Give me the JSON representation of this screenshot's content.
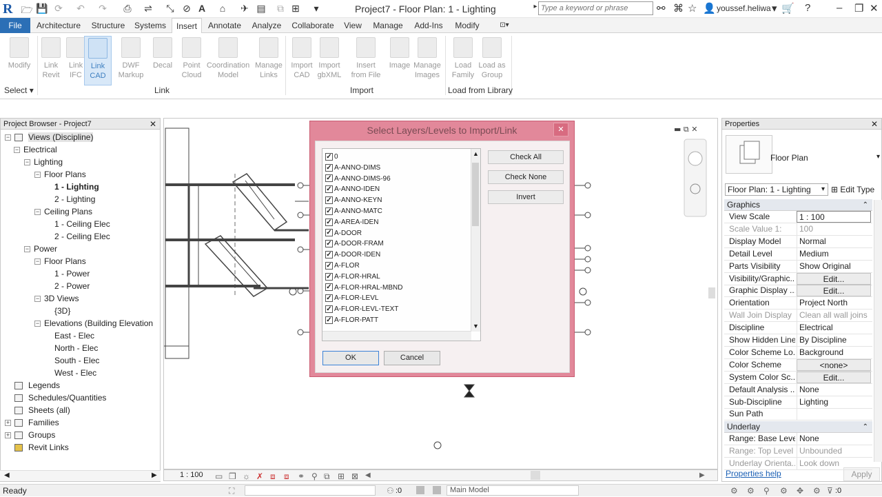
{
  "window": {
    "title": "Project7 - Floor Plan: 1 - Lighting",
    "search_placeholder": "Type a keyword or phrase",
    "user": "youssef.heliwa"
  },
  "tabs": [
    "File",
    "Architecture",
    "Structure",
    "Systems",
    "Insert",
    "Annotate",
    "Analyze",
    "Collaborate",
    "View",
    "Manage",
    "Add-Ins",
    "Modify"
  ],
  "active_tab": "Insert",
  "ribbon": {
    "buttons": [
      {
        "l1": "Modify",
        "l2": ""
      },
      {
        "l1": "Link",
        "l2": "Revit"
      },
      {
        "l1": "Link",
        "l2": "IFC"
      },
      {
        "l1": "Link",
        "l2": "CAD"
      },
      {
        "l1": "DWF",
        "l2": "Markup"
      },
      {
        "l1": "Decal",
        "l2": ""
      },
      {
        "l1": "Point",
        "l2": "Cloud"
      },
      {
        "l1": "Coordination",
        "l2": "Model"
      },
      {
        "l1": "Manage",
        "l2": "Links"
      },
      {
        "l1": "Import",
        "l2": "CAD"
      },
      {
        "l1": "Import",
        "l2": "gbXML"
      },
      {
        "l1": "Insert",
        "l2": "from File"
      },
      {
        "l1": "Image",
        "l2": ""
      },
      {
        "l1": "Manage",
        "l2": "Images"
      },
      {
        "l1": "Load",
        "l2": "Family"
      },
      {
        "l1": "Load as",
        "l2": "Group"
      }
    ],
    "panels": {
      "select": "Select",
      "link": "Link",
      "import": "Import",
      "library": "Load from Library"
    }
  },
  "project_browser": {
    "title": "Project Browser - Project7",
    "nodes": [
      {
        "t": "Views (Discipline)"
      },
      {
        "t": "Electrical"
      },
      {
        "t": "Lighting"
      },
      {
        "t": "Floor Plans"
      },
      {
        "t": "1 - Lighting"
      },
      {
        "t": "2 - Lighting"
      },
      {
        "t": "Ceiling Plans"
      },
      {
        "t": "1 - Ceiling Elec"
      },
      {
        "t": "2 - Ceiling Elec"
      },
      {
        "t": "Power"
      },
      {
        "t": "Floor Plans"
      },
      {
        "t": "1 - Power"
      },
      {
        "t": "2 - Power"
      },
      {
        "t": "3D Views"
      },
      {
        "t": "{3D}"
      },
      {
        "t": "Elevations (Building Elevation"
      },
      {
        "t": "East - Elec"
      },
      {
        "t": "North - Elec"
      },
      {
        "t": "South - Elec"
      },
      {
        "t": "West - Elec"
      },
      {
        "t": "Legends"
      },
      {
        "t": "Schedules/Quantities"
      },
      {
        "t": "Sheets (all)"
      },
      {
        "t": "Families"
      },
      {
        "t": "Groups"
      },
      {
        "t": "Revit Links"
      }
    ]
  },
  "view": {
    "scale": "1 : 100"
  },
  "dialog": {
    "title": "Select Layers/Levels to Import/Link",
    "layers": [
      "0",
      "A-ANNO-DIMS",
      "A-ANNO-DIMS-96",
      "A-ANNO-IDEN",
      "A-ANNO-KEYN",
      "A-ANNO-MATC",
      "A-AREA-IDEN",
      "A-DOOR",
      "A-DOOR-FRAM",
      "A-DOOR-IDEN",
      "A-FLOR",
      "A-FLOR-HRAL",
      "A-FLOR-HRAL-MBND",
      "A-FLOR-LEVL",
      "A-FLOR-LEVL-TEXT",
      "A-FLOR-PATT"
    ],
    "check_all": "Check All",
    "check_none": "Check None",
    "invert": "Invert",
    "ok": "OK",
    "cancel": "Cancel"
  },
  "properties": {
    "title": "Properties",
    "type_name": "Floor Plan",
    "instance": "Floor Plan: 1 - Lighting",
    "edit_type": "Edit Type",
    "groups": {
      "graphics": "Graphics",
      "underlay": "Underlay"
    },
    "graphics": [
      {
        "k": "View Scale",
        "v": "1 : 100"
      },
      {
        "k": "Scale Value    1:",
        "v": "100"
      },
      {
        "k": "Display Model",
        "v": "Normal"
      },
      {
        "k": "Detail Level",
        "v": "Medium"
      },
      {
        "k": "Parts Visibility",
        "v": "Show Original"
      },
      {
        "k": "Visibility/Graphic...",
        "v": "Edit..."
      },
      {
        "k": "Graphic Display ...",
        "v": "Edit..."
      },
      {
        "k": "Orientation",
        "v": "Project North"
      },
      {
        "k": "Wall Join Display",
        "v": "Clean all wall joins"
      },
      {
        "k": "Discipline",
        "v": "Electrical"
      },
      {
        "k": "Show Hidden Lines",
        "v": "By Discipline"
      },
      {
        "k": "Color Scheme Lo...",
        "v": "Background"
      },
      {
        "k": "Color Scheme",
        "v": "<none>"
      },
      {
        "k": "System Color Sc...",
        "v": "Edit..."
      },
      {
        "k": "Default Analysis ...",
        "v": "None"
      },
      {
        "k": "Sub-Discipline",
        "v": "Lighting"
      },
      {
        "k": "Sun Path",
        "v": ""
      }
    ],
    "underlay": [
      {
        "k": "Range: Base Level",
        "v": "None"
      },
      {
        "k": "Range: Top Level",
        "v": "Unbounded"
      },
      {
        "k": "Underlay Orienta...",
        "v": "Look down"
      }
    ],
    "help": "Properties help",
    "apply": "Apply"
  },
  "status": {
    "ready": "Ready",
    "zero": ":0",
    "main_model": "Main Model",
    "filter": ":0"
  }
}
